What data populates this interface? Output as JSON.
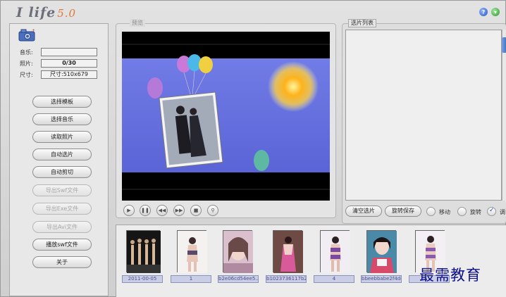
{
  "app": {
    "logo_text": "I life",
    "logo_version": "5.0",
    "help_glyph": "?",
    "min_glyph": "▾"
  },
  "info": {
    "music_label": "音乐:",
    "music_value": "",
    "photo_label": "照片:",
    "photo_value": "0/30",
    "size_label": "尺寸:",
    "size_value": "尺寸:510x679"
  },
  "buttons": [
    {
      "label": "选择模板",
      "enabled": true
    },
    {
      "label": "选择音乐",
      "enabled": true
    },
    {
      "label": "读取照片",
      "enabled": true
    },
    {
      "label": "自动选片",
      "enabled": true
    },
    {
      "label": "自动剪切",
      "enabled": true
    },
    {
      "label": "导出Swf文件",
      "enabled": false
    },
    {
      "label": "导出Exe文件",
      "enabled": false
    },
    {
      "label": "导出Avi文件",
      "enabled": false
    },
    {
      "label": "播放swf文件",
      "enabled": true
    },
    {
      "label": "关于",
      "enabled": true
    }
  ],
  "preview": {
    "legend": "预览"
  },
  "player_controls": [
    {
      "icon": "play-icon",
      "glyph": "▶"
    },
    {
      "icon": "pause-icon",
      "glyph": "❚❚"
    },
    {
      "icon": "prev-icon",
      "glyph": "◀◀"
    },
    {
      "icon": "next-icon",
      "glyph": "▶▶"
    },
    {
      "icon": "stop-icon",
      "glyph": "■"
    },
    {
      "icon": "zoom-icon",
      "glyph": "⚲"
    }
  ],
  "selected_list": {
    "legend": "选片列表",
    "clear_button": "清空选片",
    "rotate_save_button": "旋转保存",
    "move_label": "移动",
    "rotate_label": "旋转",
    "third_label": "调"
  },
  "thumbnails": [
    {
      "caption": "2011-00-05"
    },
    {
      "caption": "1"
    },
    {
      "caption": "b2e06cd54ee5..."
    },
    {
      "caption": "b1023736117b21..."
    },
    {
      "caption": "4"
    },
    {
      "caption": "bbeebbabe2f4de..."
    },
    {
      "caption": ""
    }
  ],
  "watermark": "最需教育",
  "colors": {
    "screen_bg": "#6f78e0",
    "accent": "#3c6ac2",
    "watermark": "#0c0f8a"
  }
}
